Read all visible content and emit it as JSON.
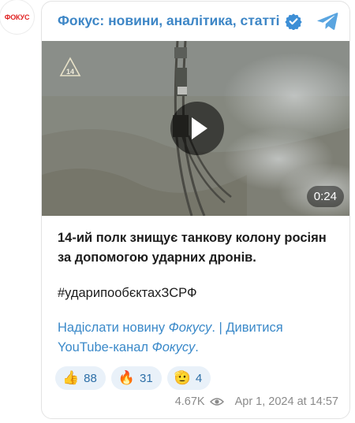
{
  "avatar": {
    "logo_text": "ФОКУС"
  },
  "channel": {
    "name": "Фокус: новини, аналітика, статті",
    "verified": true
  },
  "video": {
    "duration": "0:24",
    "overlay_badge": "14"
  },
  "post": {
    "title": "14-ий полк знищує танкову колону росіян за допомогою ударних дронів.",
    "hashtag": "#ударипообєктахЗСРФ",
    "link1_text": "Надіслати новину ",
    "link1_em": "Фокусу",
    "separator": ". | ",
    "link2_text": "Дивитися YouTube-канал ",
    "link2_em": "Фокусу",
    "link2_tail": "."
  },
  "reactions": [
    {
      "emoji": "👍",
      "count": "88"
    },
    {
      "emoji": "🔥",
      "count": "31"
    },
    {
      "emoji": "🫡",
      "count": "4"
    }
  ],
  "meta": {
    "views": "4.67K",
    "timestamp": "Apr 1, 2024 at 14:57"
  },
  "colors": {
    "accent": "#3d86c6",
    "reaction_bg": "#e9f1f9",
    "logo_red": "#e02424"
  }
}
